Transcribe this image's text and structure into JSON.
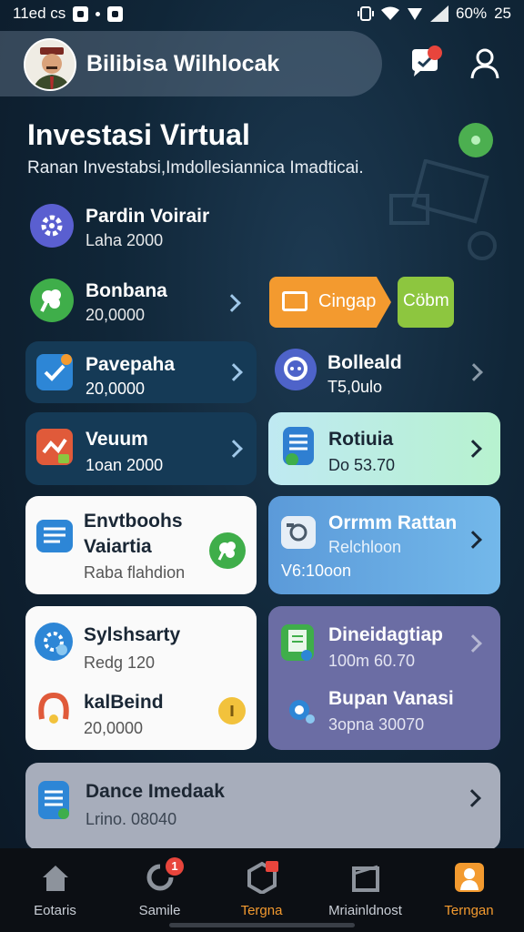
{
  "status_bar": {
    "time": "11ed cs",
    "battery": "60%",
    "extra": "25"
  },
  "header": {
    "user_name": "Bilibisa Wilhlocak"
  },
  "title_section": {
    "title": "Investasi Virtual",
    "subtitle": "Ranan Investabsi,Imdollesiannica Imadticai."
  },
  "rows": [
    {
      "title": "Pardin Voirair",
      "sub": "Laha 2000",
      "icon": "gear-icon"
    },
    {
      "title": "Bonbana",
      "sub": "20,0000",
      "icon": "broccoli-icon"
    }
  ],
  "tags": {
    "orange": "Cingap",
    "green": "Cöbm"
  },
  "cards": {
    "pavepaha": {
      "title": "Pavepaha",
      "sub": "20,0000"
    },
    "bolleald": {
      "title": "Bolleald",
      "sub": "T5,0ulo"
    },
    "veuum": {
      "title": "Veuum",
      "sub": "1oan 2000"
    },
    "rotiuia": {
      "title": "Rotiuia",
      "sub": "Do 53.70"
    },
    "envtboohs": {
      "title1": "Envtboohs",
      "title2": "Vaiartia",
      "sub": "Raba flahdion"
    },
    "orrmm": {
      "title": "Orrmm Rattan",
      "sub1": "Relchloon",
      "sub2": "V6:10oon"
    },
    "sylshsarty": {
      "title": "Sylshsarty",
      "sub": "Redg 120"
    },
    "kalbeind": {
      "title": "kalBeind",
      "sub": "20,0000"
    },
    "dineidagtiap": {
      "title": "Dineidagtiap",
      "sub": "100m 60.70"
    },
    "bupan": {
      "title": "Bupan Vanasi",
      "sub": "3opna 30070"
    },
    "dance": {
      "title": "Dance Imedaak",
      "sub": "Lrino. 08040"
    }
  },
  "bottom_nav": [
    {
      "label": "Eotaris",
      "icon": "home-icon",
      "active": false
    },
    {
      "label": "Samile",
      "icon": "refresh-icon",
      "active": false,
      "badge": "1"
    },
    {
      "label": "Tergna",
      "icon": "cube-icon",
      "active": true
    },
    {
      "label": "Mriainldnost",
      "icon": "box-icon",
      "active": false
    },
    {
      "label": "Terngan",
      "icon": "person-icon",
      "active": true
    }
  ],
  "colors": {
    "accent_orange": "#f39a2f",
    "accent_green": "#8dc63f",
    "badge_red": "#e8453c",
    "background": "#102638"
  }
}
